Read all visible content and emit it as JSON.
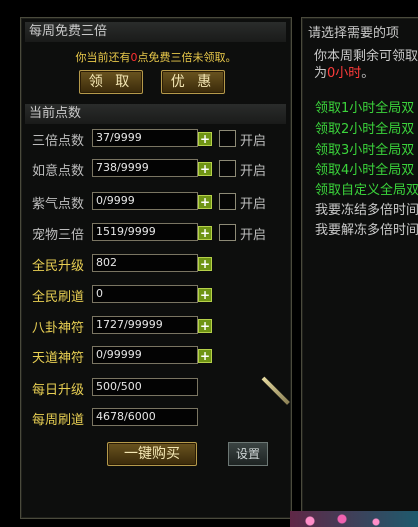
{
  "free": {
    "title": "每周免费三倍",
    "notice_prefix": "你当前还有",
    "notice_count": "0",
    "notice_suffix": "点免费三倍未领取。",
    "claim_label": "领 取",
    "offer_label": "优 惠"
  },
  "points": {
    "title": "当前点数",
    "rows": [
      {
        "label": "三倍点数",
        "value": "37/9999",
        "plus": "+",
        "check_label": "开启"
      },
      {
        "label": "如意点数",
        "value": "738/9999",
        "plus": "+",
        "check_label": "开启"
      },
      {
        "label": "紫气点数",
        "value": "0/9999",
        "plus": "+",
        "check_label": "开启"
      },
      {
        "label": "宠物三倍",
        "value": "1519/9999",
        "plus": "+",
        "check_label": "开启"
      },
      {
        "label": "全民升级",
        "value": "802",
        "plus": "+"
      },
      {
        "label": "全民刷道",
        "value": "0",
        "plus": "+"
      },
      {
        "label": "八卦神符",
        "value": "1727/99999",
        "plus": "+"
      },
      {
        "label": "天道神符",
        "value": "0/99999",
        "plus": "+"
      },
      {
        "label": "每日升级",
        "value": "500/500"
      },
      {
        "label": "每周刷道",
        "value": "4678/6000"
      }
    ],
    "buy_label": "一键购买",
    "settings_label": "设置"
  },
  "right": {
    "title": "请选择需要的项",
    "line1": "你本周剩余可领取",
    "line2_prefix": "为",
    "line2_value": "0小时",
    "line2_suffix": "。",
    "options": [
      "领取1小时全局双",
      "领取2小时全局双",
      "领取3小时全局双",
      "领取4小时全局双",
      "领取自定义全局双",
      "我要冻结多倍时间",
      "我要解冻多倍时间"
    ]
  },
  "colors": {
    "panel_bg": "#0d0e0d",
    "gold_text": "#e8cf53",
    "green_option": "#3bd43b",
    "red_value": "#ff3b3b",
    "plus_green": "#6f9414"
  },
  "icons": {
    "plus": "plus-icon",
    "checkbox": "checkbox-icon",
    "knife": "knife-icon"
  }
}
